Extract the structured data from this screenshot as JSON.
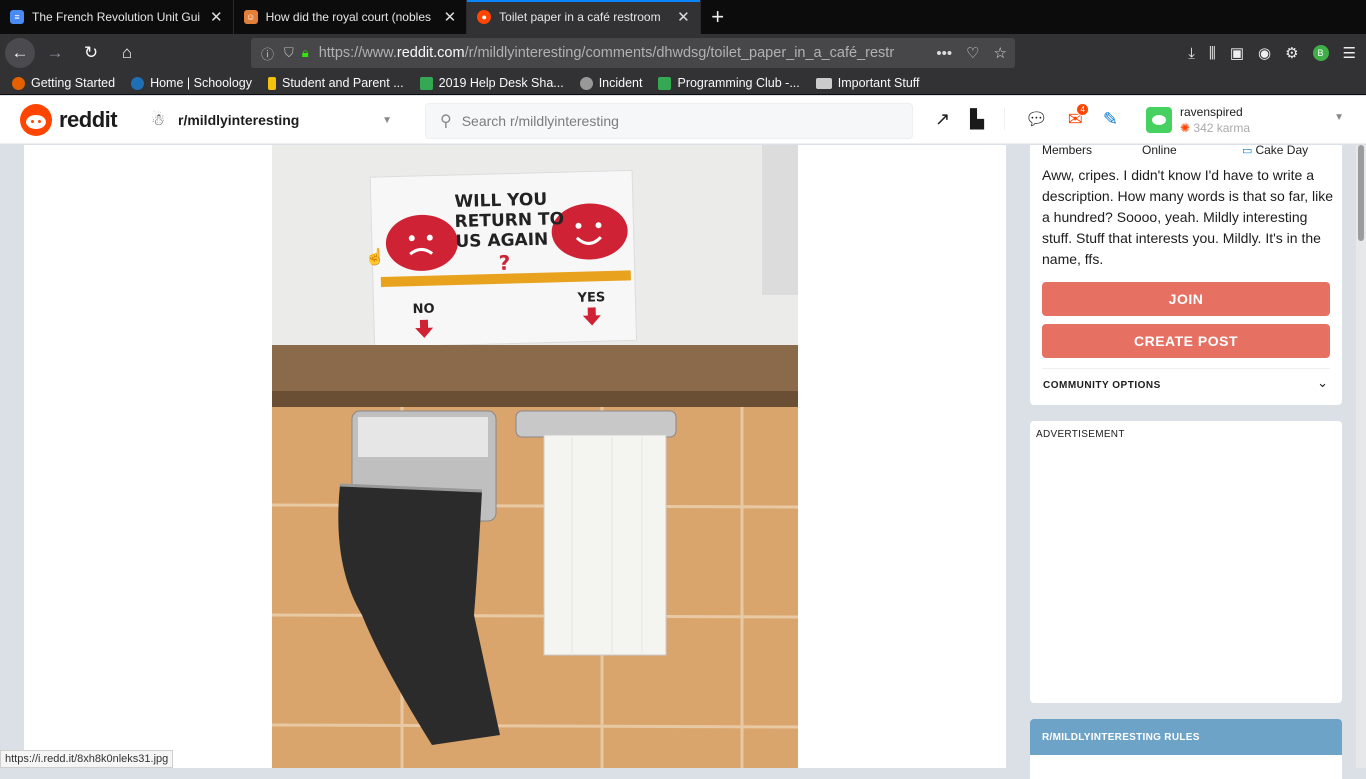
{
  "browser": {
    "tabs": [
      {
        "title": "The French Revolution Unit Gui",
        "favicon_color": "#4a8af4",
        "active": false
      },
      {
        "title": "How did the royal court (nobles",
        "favicon_color": "#e2803a",
        "active": false
      },
      {
        "title": "Toilet paper in a café restroom",
        "favicon_color": "#ff4500",
        "active": true
      }
    ],
    "url_prefix": "https://www.",
    "url_domain": "reddit.com",
    "url_path": "/r/mildlyinteresting/comments/dhwdsg/toilet_paper_in_a_café_restr",
    "bookmarks": [
      {
        "label": "Getting Started",
        "color": "#e66000"
      },
      {
        "label": "Home | Schoology",
        "color": "#1f6fb5"
      },
      {
        "label": "Student and Parent ...",
        "color": "#f4c20d"
      },
      {
        "label": "2019 Help Desk Sha...",
        "color": "#34a853"
      },
      {
        "label": "Incident",
        "color": "#999999"
      },
      {
        "label": "Programming Club -...",
        "color": "#34a853"
      },
      {
        "label": "Important Stuff",
        "color": "#cccccc"
      }
    ],
    "status_url": "https://i.redd.it/8xh8k0nleks31.jpg"
  },
  "reddit": {
    "wordmark": "reddit",
    "subreddit": "r/mildlyinteresting",
    "search_placeholder": "Search r/mildlyinteresting",
    "mail_count": "4",
    "username": "ravenspired",
    "karma": "342 karma"
  },
  "sidebar": {
    "stat_members": "Members",
    "stat_online": "Online",
    "stat_cakeday": "Cake Day",
    "description": "Aww, cripes. I didn't know I'd have to write a description. How many words is that so far, like a hundred? Soooo, yeah. Mildly interesting stuff. Stuff that interests you. Mildly. It's in the name, ffs.",
    "join_label": "JOIN",
    "create_post_label": "CREATE POST",
    "community_options_label": "COMMUNITY OPTIONS",
    "ad_label": "ADVERTISEMENT",
    "rules_label": "R/MILDLYINTERESTING RULES"
  },
  "image": {
    "sign_question": "WILL YOU RETURN TO US AGAIN",
    "sign_no": "NO",
    "sign_yes": "YES"
  },
  "colors": {
    "accent": "#ff4500",
    "join_button": "#e67163",
    "rules_header": "#6ea3c8"
  }
}
